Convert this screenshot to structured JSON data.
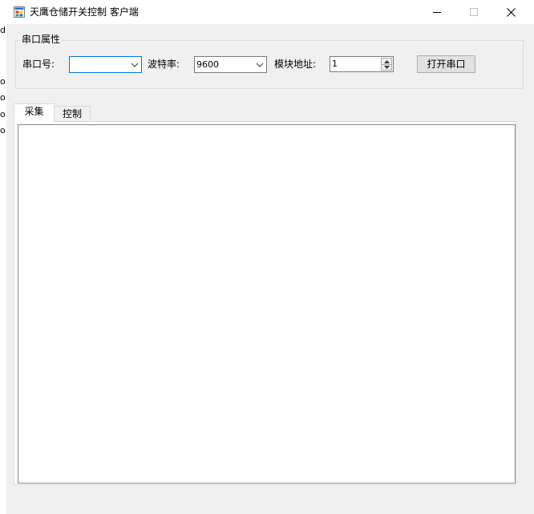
{
  "window": {
    "title": "天鹰仓储开关控制 客户端"
  },
  "background_window": {
    "fragments": [
      "dr",
      "o",
      "o",
      "o",
      "o"
    ]
  },
  "serial_group": {
    "legend": "串口属性",
    "port_label": "串口号:",
    "port_value": "",
    "baud_label": "波特率:",
    "baud_value": "9600",
    "address_label": "模块地址:",
    "address_value": "1",
    "open_button_label": "打开串口"
  },
  "tabs": [
    {
      "label": "采集",
      "active": true
    },
    {
      "label": "控制",
      "active": false
    }
  ],
  "log": {
    "content": ""
  }
}
